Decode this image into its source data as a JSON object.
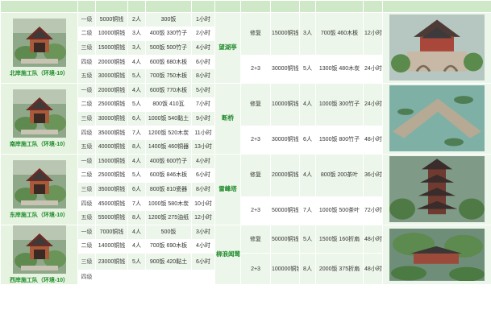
{
  "headers": [
    "",
    "",
    "",
    "",
    "",
    "",
    "",
    "",
    "",
    "",
    "",
    ""
  ],
  "upgrade_headers": [
    "",
    "",
    ""
  ],
  "sections": [
    {
      "team": "北岸施工队（环境-10）",
      "building": "望湖亭",
      "levels": [
        {
          "lv": "一级",
          "cost": "5000铜钱",
          "people": "2人",
          "mat": "300饭",
          "time": "1小时"
        },
        {
          "lv": "二级",
          "cost": "10000铜钱",
          "people": "3人",
          "mat": "400饭 330竹子",
          "time": "2小时"
        },
        {
          "lv": "三级",
          "cost": "15000铜钱",
          "people": "3人",
          "mat": "500饭 500竹子",
          "time": "4小时"
        },
        {
          "lv": "四级",
          "cost": "20000铜钱",
          "people": "4人",
          "mat": "600饭 680木板",
          "time": "6小时"
        },
        {
          "lv": "五级",
          "cost": "30000铜钱",
          "people": "5人",
          "mat": "700饭 750木板",
          "time": "8小时"
        }
      ],
      "upgrades": [
        {
          "type": "修复",
          "cost": "15000铜钱",
          "people": "3人",
          "mat": "700饭 460木板",
          "time": "12小时"
        },
        {
          "type": "2+3",
          "cost": "30000铜钱",
          "people": "5人",
          "mat": "1300饭 480木炭",
          "time": "24小时"
        }
      ]
    },
    {
      "team": "南岸施工队（环境-10）",
      "building": "断桥",
      "levels": [
        {
          "lv": "一级",
          "cost": "20000铜钱",
          "people": "4人",
          "mat": "600饭 770木板",
          "time": "5小时"
        },
        {
          "lv": "二级",
          "cost": "25000铜钱",
          "people": "5人",
          "mat": "800饭 410瓦",
          "time": "7小时"
        },
        {
          "lv": "三级",
          "cost": "30000铜钱",
          "people": "6人",
          "mat": "1000饭 540黏土",
          "time": "9小时"
        },
        {
          "lv": "四级",
          "cost": "35000铜钱",
          "people": "7人",
          "mat": "1200饭 520木炭",
          "time": "11小时"
        },
        {
          "lv": "五级",
          "cost": "40000铜钱",
          "people": "8人",
          "mat": "1400饭 460铜器",
          "time": "13小时"
        }
      ],
      "upgrades": [
        {
          "type": "修复",
          "cost": "10000铜钱",
          "people": "4人",
          "mat": "1000饭 300竹子",
          "time": "24小时"
        },
        {
          "type": "2+3",
          "cost": "30000铜钱",
          "people": "6人",
          "mat": "1500饭 800竹子",
          "time": "48小时"
        }
      ]
    },
    {
      "team": "东岸施工队（环境-10）",
      "building": "雷峰塔",
      "levels": [
        {
          "lv": "一级",
          "cost": "15000铜钱",
          "people": "4人",
          "mat": "400饭 600竹子",
          "time": "4小时"
        },
        {
          "lv": "二级",
          "cost": "25000铜钱",
          "people": "5人",
          "mat": "600饭 846木板",
          "time": "6小时"
        },
        {
          "lv": "三级",
          "cost": "35000铜钱",
          "people": "6人",
          "mat": "800饭 810瓷器",
          "time": "8小时"
        },
        {
          "lv": "四级",
          "cost": "45000铜钱",
          "people": "7人",
          "mat": "1000饭 580木炭",
          "time": "10小时"
        },
        {
          "lv": "五级",
          "cost": "55000铜钱",
          "people": "8人",
          "mat": "1200饭 275油纸",
          "time": "12小时"
        }
      ],
      "upgrades": [
        {
          "type": "修复",
          "cost": "20000铜钱",
          "people": "4人",
          "mat": "800饭 200茶叶",
          "time": "36小时"
        },
        {
          "type": "2+3",
          "cost": "50000铜钱",
          "people": "7人",
          "mat": "1000饭 500茶叶",
          "time": "72小时"
        }
      ]
    },
    {
      "team": "西岸施工队（环境-10）",
      "building": "柳浪闻莺",
      "levels": [
        {
          "lv": "一级",
          "cost": "7000铜钱",
          "people": "4人",
          "mat": "500饭",
          "time": "3小时"
        },
        {
          "lv": "二级",
          "cost": "14000铜钱",
          "people": "4人",
          "mat": "700饭 690木板",
          "time": "4小时"
        },
        {
          "lv": "三级",
          "cost": "23000铜钱",
          "people": "5人",
          "mat": "900饭 420黏土",
          "time": "6小时"
        },
        {
          "lv": "四级",
          "cost": "",
          "people": "",
          "mat": "",
          "time": ""
        }
      ],
      "upgrades": [
        {
          "type": "修复",
          "cost": "50000铜钱",
          "people": "5人",
          "mat": "1500饭 160折扇",
          "time": "48小时"
        },
        {
          "type": "2+3",
          "cost": "100000铜钱",
          "people": "8人",
          "mat": "2000饭 375折扇",
          "time": "48小时"
        }
      ]
    }
  ],
  "colors": {
    "header": "#cfe9c8",
    "row_a": "#edf6ea",
    "row_b": "#ffffff",
    "accent": "#1f8c2b"
  }
}
